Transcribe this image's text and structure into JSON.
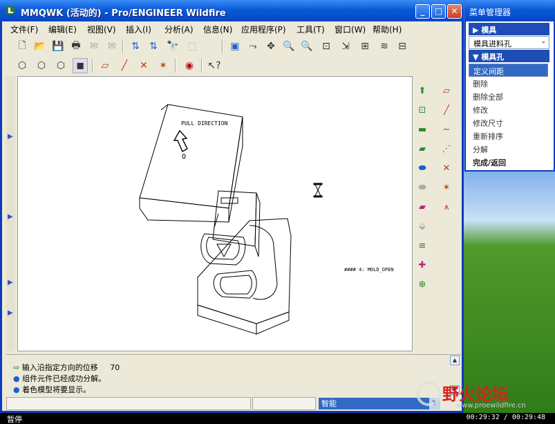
{
  "window": {
    "title": "MMQWK (活动的) - Pro/ENGINEER Wildfire",
    "minimize": "_",
    "maximize": "□",
    "close": "✕"
  },
  "menu": [
    "文件(F)",
    "编辑(E)",
    "视图(V)",
    "插入(I)",
    "分析(A)",
    "信息(N)",
    "应用程序(P)",
    "工具(T)",
    "窗口(W)",
    "帮助(H)"
  ],
  "canvas": {
    "pull_direction": "PULL DIRECTION",
    "mold_open": "#### 4: MOLD_OPEN"
  },
  "messages": {
    "prompt": "输入沿指定方向的位移",
    "prompt_value": "70",
    "line2": "组件元件已经成功分解。",
    "line3": "着色模型将要显示。"
  },
  "filter": {
    "selected": "智能"
  },
  "statusbar": {
    "left": "暂停",
    "right": "00:29:32 / 00:29:48"
  },
  "menu_manager": {
    "title": "菜单管理器",
    "section1": "模具",
    "dropdown": "模具进料孔",
    "section2": "模具孔",
    "items": [
      "定义间距",
      "删除",
      "删除全部",
      "修改",
      "修改尺寸",
      "重新排序",
      "分解",
      "完成/返回"
    ]
  },
  "watermark": {
    "text": "野火论坛",
    "url": "www.proewildfire.cn"
  },
  "colors": {
    "titlebar": "#0a5ad8",
    "window_bg": "#ece9d8",
    "selection": "#316ac5"
  }
}
